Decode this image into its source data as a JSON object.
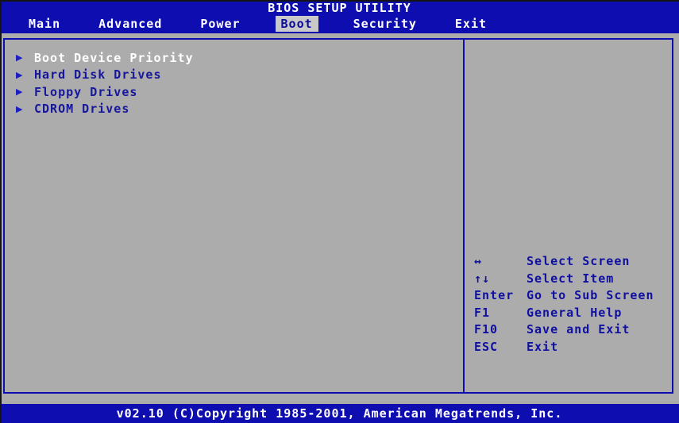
{
  "title_bar": {
    "title": "BIOS SETUP UTILITY"
  },
  "menu": {
    "tabs": [
      {
        "label": "Main",
        "active": false
      },
      {
        "label": "Advanced",
        "active": false
      },
      {
        "label": "Power",
        "active": false
      },
      {
        "label": "Boot",
        "active": true
      },
      {
        "label": "Security",
        "active": false
      },
      {
        "label": "Exit",
        "active": false
      }
    ]
  },
  "boot_menu": {
    "arrow_icon": "▶",
    "items": [
      {
        "label": "Boot Device Priority",
        "selected": true
      },
      {
        "label": "Hard Disk Drives",
        "selected": false
      },
      {
        "label": "Floppy Drives",
        "selected": false
      },
      {
        "label": "CDROM Drives",
        "selected": false
      }
    ]
  },
  "help_panel": {
    "rows": [
      {
        "key": "↔",
        "action": "Select Screen"
      },
      {
        "key": "↑↓",
        "action": "Select Item"
      },
      {
        "key": "Enter",
        "action": "Go to Sub Screen"
      },
      {
        "key": "F1",
        "action": "General Help"
      },
      {
        "key": "F10",
        "action": "Save and Exit"
      },
      {
        "key": "ESC",
        "action": "Exit"
      }
    ]
  },
  "footer": {
    "text": "v02.10 (C)Copyright 1985-2001, American Megatrends, Inc."
  },
  "colors": {
    "blue": "#0e0eb0",
    "gray": "#acacac",
    "tab_active_bg": "#c9c9c9",
    "item_text": "#17179a",
    "arrow": "#1d1dc4",
    "help_text": "#10109e",
    "selected_text": "#ffffff"
  }
}
